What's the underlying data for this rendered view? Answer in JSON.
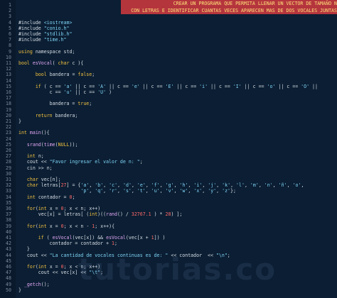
{
  "header_comment": [
    "CREAR UN PROGRAMA QUE PERMITA LLENAR UN VECTOR DE TAMAÑO N",
    "CON LETRAS E IDENTIFICAR CUANTAS VECES APARECEN MAS DE DOS VOCALES JUNTAS"
  ],
  "lines": [
    {
      "n": "1",
      "tokens": []
    },
    {
      "n": "2",
      "tokens": []
    },
    {
      "n": "3",
      "tokens": []
    },
    {
      "n": "4",
      "tokens": [
        {
          "t": "#include ",
          "c": "pp"
        },
        {
          "t": "<iostream>",
          "c": "str"
        }
      ]
    },
    {
      "n": "5",
      "tokens": [
        {
          "t": "#include ",
          "c": "pp"
        },
        {
          "t": "\"conio.h\"",
          "c": "str"
        }
      ]
    },
    {
      "n": "6",
      "tokens": [
        {
          "t": "#include ",
          "c": "pp"
        },
        {
          "t": "\"stdlib.h\"",
          "c": "str"
        }
      ]
    },
    {
      "n": "7",
      "tokens": [
        {
          "t": "#include ",
          "c": "pp"
        },
        {
          "t": "\"time.h\"",
          "c": "str"
        }
      ]
    },
    {
      "n": "8",
      "tokens": []
    },
    {
      "n": "9",
      "tokens": [
        {
          "t": "using ",
          "c": "kw"
        },
        {
          "t": "namespace std;",
          "c": ""
        }
      ]
    },
    {
      "n": "10",
      "tokens": []
    },
    {
      "n": "11",
      "tokens": [
        {
          "t": "bool ",
          "c": "kw"
        },
        {
          "t": "esVocal",
          "c": "fn"
        },
        {
          "t": "( ",
          "c": ""
        },
        {
          "t": "char",
          "c": "kw"
        },
        {
          "t": " c ){",
          "c": ""
        }
      ]
    },
    {
      "n": "12",
      "tokens": []
    },
    {
      "n": "13",
      "tokens": [
        {
          "t": "      ",
          "c": ""
        },
        {
          "t": "bool ",
          "c": "kw"
        },
        {
          "t": "bandera = ",
          "c": ""
        },
        {
          "t": "false",
          "c": "kw"
        },
        {
          "t": ";",
          "c": ""
        }
      ]
    },
    {
      "n": "14",
      "tokens": []
    },
    {
      "n": "15",
      "tokens": [
        {
          "t": "      ",
          "c": ""
        },
        {
          "t": "if",
          "c": "kw"
        },
        {
          "t": " ( c == ",
          "c": ""
        },
        {
          "t": "'a'",
          "c": "str"
        },
        {
          "t": " || c == ",
          "c": ""
        },
        {
          "t": "'A'",
          "c": "str"
        },
        {
          "t": " || c == ",
          "c": ""
        },
        {
          "t": "'e'",
          "c": "str"
        },
        {
          "t": " || c == ",
          "c": ""
        },
        {
          "t": "'E'",
          "c": "str"
        },
        {
          "t": " || c == ",
          "c": ""
        },
        {
          "t": "'i'",
          "c": "str"
        },
        {
          "t": " || c == ",
          "c": ""
        },
        {
          "t": "'I'",
          "c": "str"
        },
        {
          "t": " || c == ",
          "c": ""
        },
        {
          "t": "'o'",
          "c": "str"
        },
        {
          "t": " || c == ",
          "c": ""
        },
        {
          "t": "'O'",
          "c": "str"
        },
        {
          "t": " ||",
          "c": ""
        }
      ]
    },
    {
      "n": "16",
      "tokens": [
        {
          "t": "           c == ",
          "c": ""
        },
        {
          "t": "'u'",
          "c": "str"
        },
        {
          "t": " || c == ",
          "c": ""
        },
        {
          "t": "'U'",
          "c": "str"
        },
        {
          "t": " )",
          "c": ""
        }
      ]
    },
    {
      "n": "17",
      "tokens": []
    },
    {
      "n": "18",
      "tokens": [
        {
          "t": "           bandera = ",
          "c": ""
        },
        {
          "t": "true",
          "c": "kw"
        },
        {
          "t": ";",
          "c": ""
        }
      ]
    },
    {
      "n": "19",
      "tokens": []
    },
    {
      "n": "20",
      "tokens": [
        {
          "t": "      ",
          "c": ""
        },
        {
          "t": "return",
          "c": "kw"
        },
        {
          "t": " bandera;",
          "c": ""
        }
      ]
    },
    {
      "n": "21",
      "tokens": [
        {
          "t": "}",
          "c": ""
        }
      ]
    },
    {
      "n": "22",
      "tokens": []
    },
    {
      "n": "23",
      "tokens": [
        {
          "t": "int ",
          "c": "kw"
        },
        {
          "t": "main",
          "c": "fn"
        },
        {
          "t": "(){",
          "c": ""
        }
      ]
    },
    {
      "n": "24",
      "tokens": []
    },
    {
      "n": "25",
      "tokens": [
        {
          "t": "   ",
          "c": ""
        },
        {
          "t": "srand",
          "c": "fn"
        },
        {
          "t": "(",
          "c": ""
        },
        {
          "t": "time",
          "c": "fn"
        },
        {
          "t": "(",
          "c": ""
        },
        {
          "t": "NULL",
          "c": "kw"
        },
        {
          "t": "));",
          "c": ""
        }
      ]
    },
    {
      "n": "26",
      "tokens": []
    },
    {
      "n": "27",
      "tokens": [
        {
          "t": "   ",
          "c": ""
        },
        {
          "t": "int",
          "c": "kw"
        },
        {
          "t": " n;",
          "c": ""
        }
      ]
    },
    {
      "n": "28",
      "tokens": [
        {
          "t": "   cout << ",
          "c": ""
        },
        {
          "t": "\"Favor ingresar el valor de n: \"",
          "c": "str"
        },
        {
          "t": ";",
          "c": ""
        }
      ]
    },
    {
      "n": "29",
      "tokens": [
        {
          "t": "   cin >> n;",
          "c": ""
        }
      ]
    },
    {
      "n": "30",
      "tokens": []
    },
    {
      "n": "31",
      "tokens": [
        {
          "t": "   ",
          "c": ""
        },
        {
          "t": "char",
          "c": "kw"
        },
        {
          "t": " vec[n];",
          "c": ""
        }
      ]
    },
    {
      "n": "32",
      "tokens": [
        {
          "t": "   ",
          "c": ""
        },
        {
          "t": "char",
          "c": "kw"
        },
        {
          "t": " letras[",
          "c": ""
        },
        {
          "t": "27",
          "c": "num"
        },
        {
          "t": "] = {",
          "c": ""
        },
        {
          "t": "'a'",
          "c": "str"
        },
        {
          "t": ", ",
          "c": ""
        },
        {
          "t": "'b'",
          "c": "str"
        },
        {
          "t": ", ",
          "c": ""
        },
        {
          "t": "'c'",
          "c": "str"
        },
        {
          "t": ", ",
          "c": ""
        },
        {
          "t": "'d'",
          "c": "str"
        },
        {
          "t": ", ",
          "c": ""
        },
        {
          "t": "'e'",
          "c": "str"
        },
        {
          "t": ", ",
          "c": ""
        },
        {
          "t": "'f'",
          "c": "str"
        },
        {
          "t": ", ",
          "c": ""
        },
        {
          "t": "'g'",
          "c": "str"
        },
        {
          "t": ", ",
          "c": ""
        },
        {
          "t": "'h'",
          "c": "str"
        },
        {
          "t": ", ",
          "c": ""
        },
        {
          "t": "'i'",
          "c": "str"
        },
        {
          "t": ", ",
          "c": ""
        },
        {
          "t": "'j'",
          "c": "str"
        },
        {
          "t": ", ",
          "c": ""
        },
        {
          "t": "'k'",
          "c": "str"
        },
        {
          "t": ", ",
          "c": ""
        },
        {
          "t": "'l'",
          "c": "str"
        },
        {
          "t": ", ",
          "c": ""
        },
        {
          "t": "'m'",
          "c": "str"
        },
        {
          "t": ", ",
          "c": ""
        },
        {
          "t": "'n'",
          "c": "str"
        },
        {
          "t": ", ",
          "c": ""
        },
        {
          "t": "'ñ'",
          "c": "str"
        },
        {
          "t": ", ",
          "c": ""
        },
        {
          "t": "'o'",
          "c": "str"
        },
        {
          "t": ",",
          "c": ""
        }
      ]
    },
    {
      "n": "33",
      "tokens": [
        {
          "t": "                      ",
          "c": ""
        },
        {
          "t": "'p'",
          "c": "str"
        },
        {
          "t": ", ",
          "c": ""
        },
        {
          "t": "'q'",
          "c": "str"
        },
        {
          "t": ", ",
          "c": ""
        },
        {
          "t": "'r'",
          "c": "str"
        },
        {
          "t": ", ",
          "c": ""
        },
        {
          "t": "'s'",
          "c": "str"
        },
        {
          "t": ", ",
          "c": ""
        },
        {
          "t": "'t'",
          "c": "str"
        },
        {
          "t": ", ",
          "c": ""
        },
        {
          "t": "'u'",
          "c": "str"
        },
        {
          "t": ", ",
          "c": ""
        },
        {
          "t": "'v'",
          "c": "str"
        },
        {
          "t": ", ",
          "c": ""
        },
        {
          "t": "'w'",
          "c": "str"
        },
        {
          "t": ", ",
          "c": ""
        },
        {
          "t": "'x'",
          "c": "str"
        },
        {
          "t": ", ",
          "c": ""
        },
        {
          "t": "'y'",
          "c": "str"
        },
        {
          "t": ", ",
          "c": ""
        },
        {
          "t": "'z'",
          "c": "str"
        },
        {
          "t": "};",
          "c": ""
        }
      ]
    },
    {
      "n": "34",
      "tokens": [
        {
          "t": "   ",
          "c": ""
        },
        {
          "t": "int",
          "c": "kw"
        },
        {
          "t": " contador = ",
          "c": ""
        },
        {
          "t": "0",
          "c": "num"
        },
        {
          "t": ";",
          "c": ""
        }
      ]
    },
    {
      "n": "35",
      "tokens": []
    },
    {
      "n": "36",
      "tokens": [
        {
          "t": "   ",
          "c": ""
        },
        {
          "t": "for",
          "c": "kw"
        },
        {
          "t": "(",
          "c": ""
        },
        {
          "t": "int",
          "c": "kw"
        },
        {
          "t": " x = ",
          "c": ""
        },
        {
          "t": "0",
          "c": "num"
        },
        {
          "t": "; x < n; x++)",
          "c": ""
        }
      ]
    },
    {
      "n": "37",
      "tokens": [
        {
          "t": "       vec[x] = letras[ (",
          "c": ""
        },
        {
          "t": "int",
          "c": "kw"
        },
        {
          "t": ")((",
          "c": ""
        },
        {
          "t": "rand",
          "c": "fn"
        },
        {
          "t": "() / ",
          "c": ""
        },
        {
          "t": "32767.1",
          "c": "num"
        },
        {
          "t": " ) * ",
          "c": ""
        },
        {
          "t": "28",
          "c": "num"
        },
        {
          "t": ") ];",
          "c": ""
        }
      ]
    },
    {
      "n": "38",
      "tokens": []
    },
    {
      "n": "39",
      "tokens": [
        {
          "t": "   ",
          "c": ""
        },
        {
          "t": "for",
          "c": "kw"
        },
        {
          "t": "(",
          "c": ""
        },
        {
          "t": "int",
          "c": "kw"
        },
        {
          "t": " x = ",
          "c": ""
        },
        {
          "t": "0",
          "c": "num"
        },
        {
          "t": "; x < n - ",
          "c": ""
        },
        {
          "t": "1",
          "c": "num"
        },
        {
          "t": "; x++){",
          "c": ""
        }
      ]
    },
    {
      "n": "40",
      "tokens": []
    },
    {
      "n": "41",
      "tokens": [
        {
          "t": "       ",
          "c": ""
        },
        {
          "t": "if",
          "c": "kw"
        },
        {
          "t": " ( ",
          "c": ""
        },
        {
          "t": "esVocal",
          "c": "fn"
        },
        {
          "t": "(vec[x]) && ",
          "c": ""
        },
        {
          "t": "esVocal",
          "c": "fn"
        },
        {
          "t": "(vec[x + ",
          "c": ""
        },
        {
          "t": "1",
          "c": "num"
        },
        {
          "t": "]) )",
          "c": ""
        }
      ]
    },
    {
      "n": "42",
      "tokens": [
        {
          "t": "           contador = contador + ",
          "c": ""
        },
        {
          "t": "1",
          "c": "num"
        },
        {
          "t": ";",
          "c": ""
        }
      ]
    },
    {
      "n": "43",
      "tokens": [
        {
          "t": "   }",
          "c": ""
        }
      ]
    },
    {
      "n": "44",
      "tokens": [
        {
          "t": "   cout << ",
          "c": ""
        },
        {
          "t": "\"La cantidad de vocales continuas es de: \"",
          "c": "str"
        },
        {
          "t": " << contador  << ",
          "c": ""
        },
        {
          "t": "\"\\n\"",
          "c": "str"
        },
        {
          "t": ";",
          "c": ""
        }
      ]
    },
    {
      "n": "45",
      "tokens": []
    },
    {
      "n": "46",
      "tokens": [
        {
          "t": "   ",
          "c": ""
        },
        {
          "t": "for",
          "c": "kw"
        },
        {
          "t": "(",
          "c": ""
        },
        {
          "t": "int",
          "c": "kw"
        },
        {
          "t": " x = ",
          "c": ""
        },
        {
          "t": "0",
          "c": "num"
        },
        {
          "t": "; x < n; x++)",
          "c": ""
        }
      ]
    },
    {
      "n": "47",
      "tokens": [
        {
          "t": "       cout << vec[x] << ",
          "c": ""
        },
        {
          "t": "\"\\t\"",
          "c": "str"
        },
        {
          "t": ";",
          "c": ""
        }
      ]
    },
    {
      "n": "48",
      "tokens": []
    },
    {
      "n": "49",
      "tokens": [
        {
          "t": "  ",
          "c": ""
        },
        {
          "t": "_getch",
          "c": "fn"
        },
        {
          "t": "();",
          "c": ""
        }
      ]
    },
    {
      "n": "50",
      "tokens": [
        {
          "t": "}",
          "c": ""
        }
      ]
    }
  ],
  "watermark": "tutorias.co",
  "colors": {
    "background": "#0b1e33",
    "keyword": "#f0c040",
    "string": "#7fd4f7",
    "number": "#ff6a6a",
    "function": "#e0a6f5",
    "highlight": "#b5353d"
  }
}
